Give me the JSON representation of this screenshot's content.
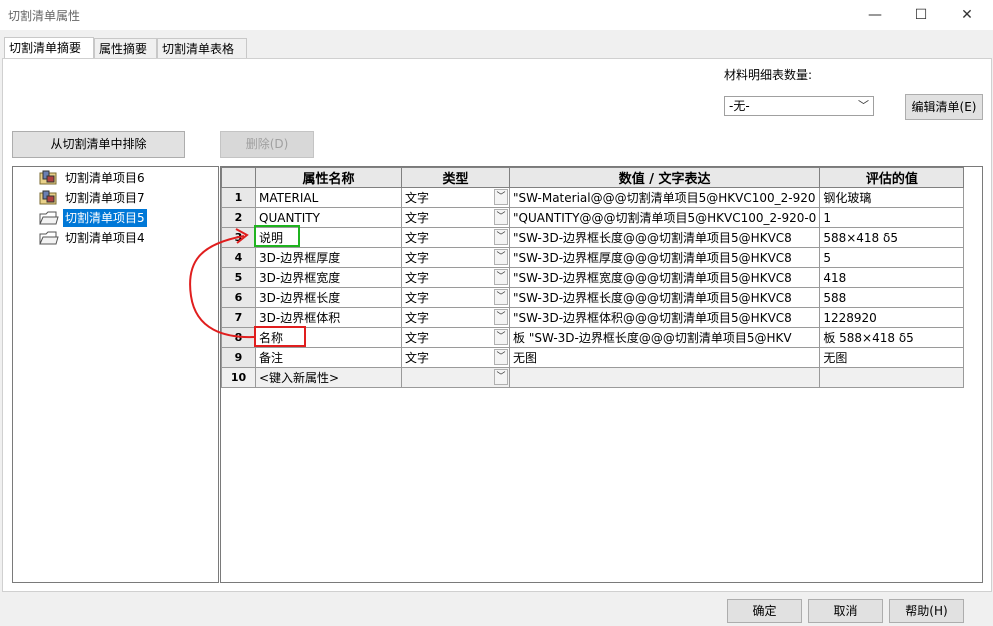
{
  "window": {
    "title": "切割清单属性",
    "minimize": "—",
    "maximize": "☐",
    "close": "✕"
  },
  "tabs": [
    {
      "label": "切割清单摘要"
    },
    {
      "label": "属性摘要"
    },
    {
      "label": "切割清单表格"
    }
  ],
  "bom": {
    "label": "材料明细表数量:",
    "selected": "-无-",
    "edit_button": "编辑清单(E)"
  },
  "buttons": {
    "exclude": "从切割清单中排除",
    "delete": "删除(D)",
    "ok": "确定",
    "cancel": "取消",
    "help": "帮助(H)"
  },
  "tree": {
    "items": [
      {
        "label": "切割清单项目6",
        "icon": "weldment-icon"
      },
      {
        "label": "切割清单项目7",
        "icon": "weldment-icon"
      },
      {
        "label": "切割清单项目5",
        "icon": "folder-icon",
        "selected": true
      },
      {
        "label": "切割清单项目4",
        "icon": "folder-icon"
      }
    ]
  },
  "grid": {
    "headers": [
      "",
      "属性名称",
      "类型",
      "数值 / 文字表达",
      "评估的值"
    ],
    "rows": [
      {
        "n": "1",
        "name": "MATERIAL",
        "type": "文字",
        "expr": "\"SW-Material@@@切割清单项目5@HKVC100_2-920",
        "value": "钢化玻璃"
      },
      {
        "n": "2",
        "name": "QUANTITY",
        "type": "文字",
        "expr": "\"QUANTITY@@@切割清单项目5@HKVC100_2-920-0",
        "value": "1"
      },
      {
        "n": "3",
        "name": "说明",
        "type": "文字",
        "expr": "\"SW-3D-边界框长度@@@切割清单项目5@HKVC8",
        "value": "588×418  δ5"
      },
      {
        "n": "4",
        "name": "3D-边界框厚度",
        "type": "文字",
        "expr": "\"SW-3D-边界框厚度@@@切割清单项目5@HKVC8",
        "value": "5"
      },
      {
        "n": "5",
        "name": "3D-边界框宽度",
        "type": "文字",
        "expr": "\"SW-3D-边界框宽度@@@切割清单项目5@HKVC8",
        "value": "418"
      },
      {
        "n": "6",
        "name": "3D-边界框长度",
        "type": "文字",
        "expr": "\"SW-3D-边界框长度@@@切割清单项目5@HKVC8",
        "value": "588"
      },
      {
        "n": "7",
        "name": "3D-边界框体积",
        "type": "文字",
        "expr": "\"SW-3D-边界框体积@@@切割清单项目5@HKVC8",
        "value": "1228920"
      },
      {
        "n": "8",
        "name": "名称",
        "type": "文字",
        "expr": "板 \"SW-3D-边界框长度@@@切割清单项目5@HKV",
        "value": "板 588×418  δ5"
      },
      {
        "n": "9",
        "name": "备注",
        "type": "文字",
        "expr": "无图",
        "value": "无图"
      },
      {
        "n": "10",
        "name": "<键入新属性>",
        "type": "",
        "expr": "",
        "value": ""
      }
    ]
  },
  "colors": {
    "selection": "#0078d7",
    "annotation_green": "#1fb31f",
    "annotation_red": "#e01e1e"
  }
}
